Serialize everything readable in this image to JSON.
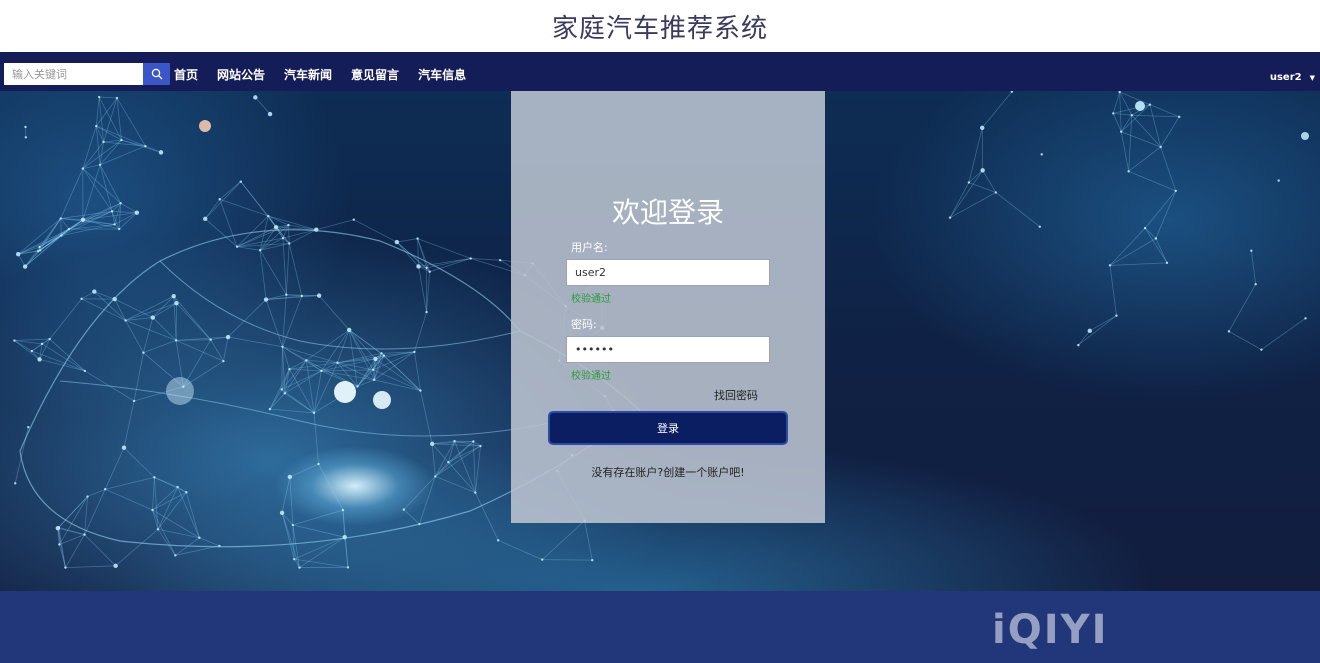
{
  "site": {
    "title": "家庭汽车推荐系统"
  },
  "nav": {
    "search_placeholder": "输入关键词",
    "search_icon": "search-icon",
    "links": [
      "首页",
      "网站公告",
      "汽车新闻",
      "意见留言",
      "汽车信息"
    ],
    "user": "user2"
  },
  "login": {
    "title": "欢迎登录",
    "username_label": "用户名:",
    "username_value": "user2",
    "username_status": "校验通过",
    "password_label": "密码:",
    "password_value": "••••••",
    "password_status": "校验通过",
    "forgot": "找回密码",
    "submit": "登录",
    "register": "没有存在账户?创建一个账户吧!"
  },
  "watermark": {
    "text": "iQIYI"
  },
  "colors": {
    "nav_bg": "#141d57",
    "search_button": "#3b57c7",
    "login_button": "#0c1e62",
    "valid": "#2e9b3a",
    "footer": "#22367a"
  }
}
